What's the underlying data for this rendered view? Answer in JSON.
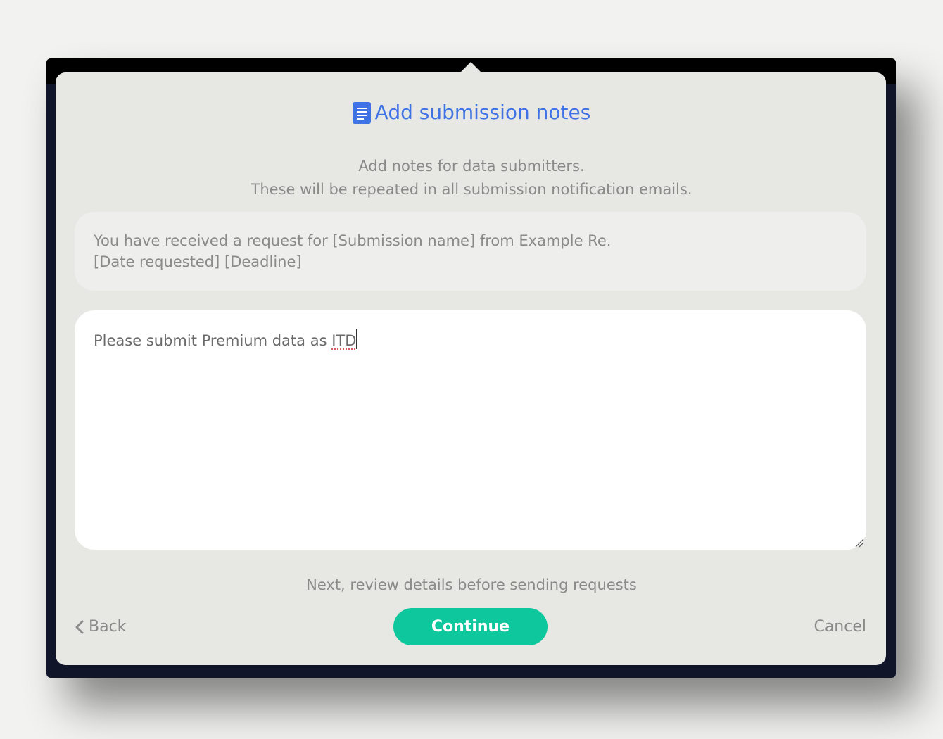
{
  "dialog": {
    "title": "Add submission notes",
    "title_icon": "document-icon",
    "subtitle_line1": "Add notes for data submitters.",
    "subtitle_line2": "These will be repeated in all submission notification emails.",
    "template_line1": "You have received a request for [Submission name] from Example Re.",
    "template_line2": "[Date requested] [Deadline]",
    "notes_prefix": "Please submit Premium data as ",
    "notes_misspelled": "ITD",
    "next_hint": "Next, review details before sending requests",
    "back_label": "Back",
    "continue_label": "Continue",
    "cancel_label": "Cancel"
  },
  "colors": {
    "accent": "#3f73e5",
    "primary_button": "#0ec79d",
    "dialog_bg": "#e7e7e3",
    "backdrop": "#11152a"
  }
}
